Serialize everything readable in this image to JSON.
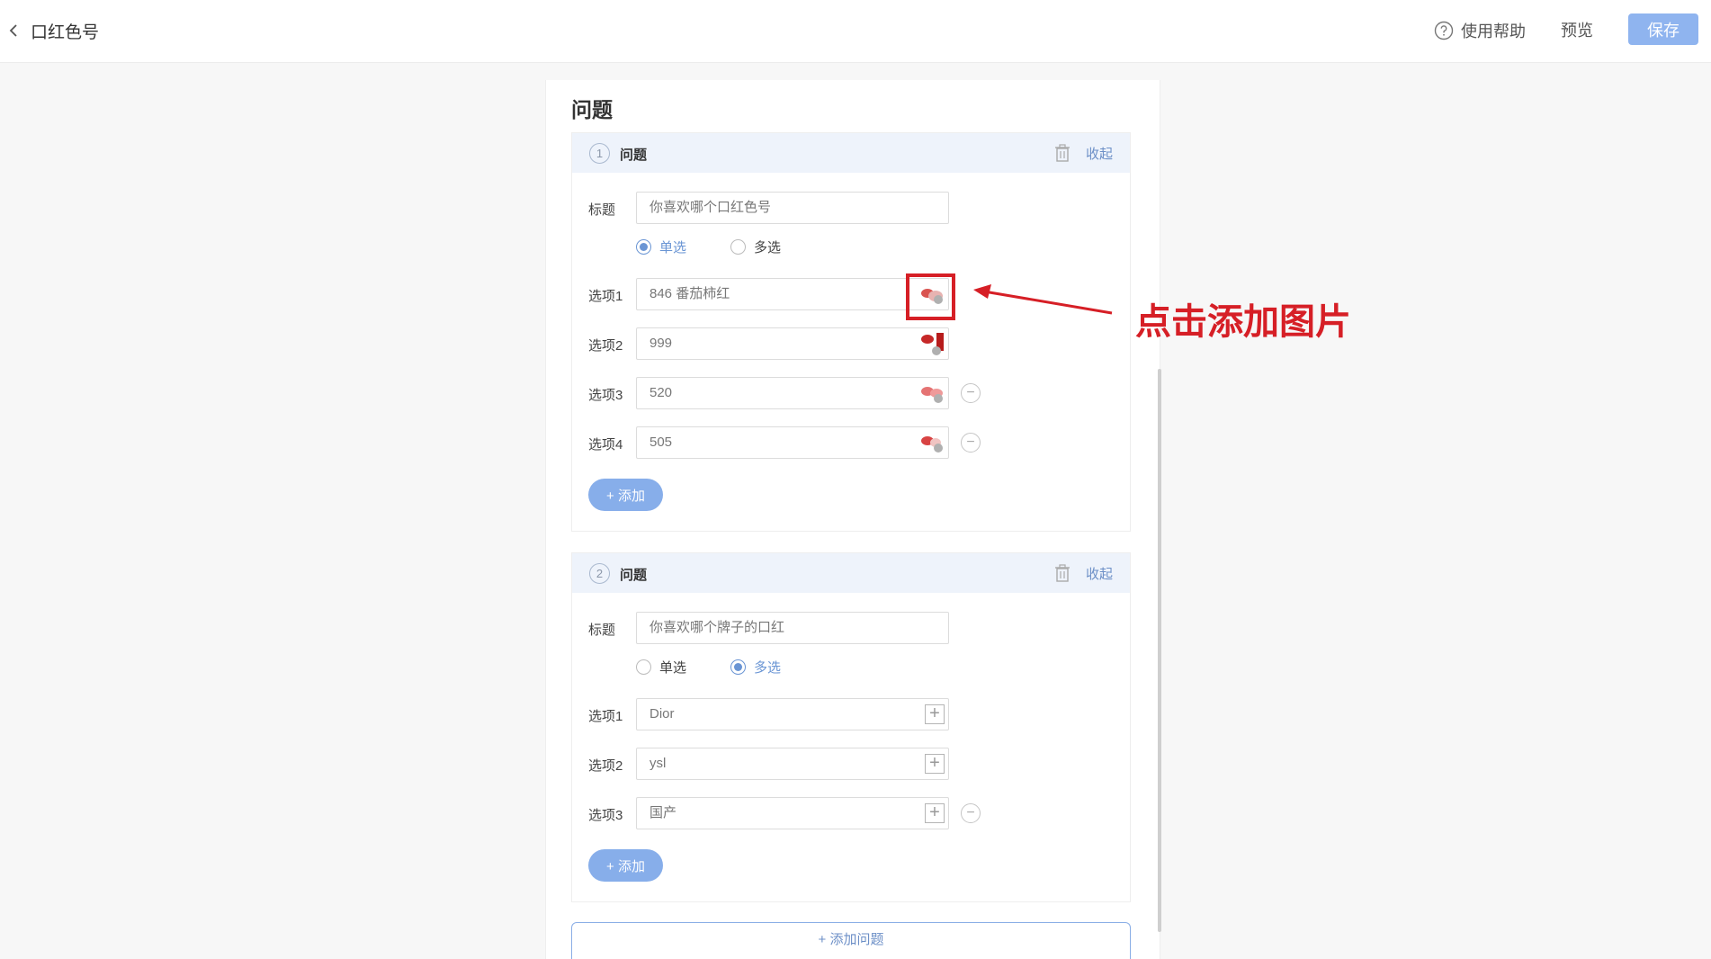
{
  "header": {
    "back_title": "口红色号",
    "help_label": "使用帮助",
    "preview_label": "预览",
    "save_label": "保存"
  },
  "panel": {
    "title": "问题"
  },
  "questions": [
    {
      "number": "1",
      "label": "问题",
      "collapse_label": "收起",
      "title_label": "标题",
      "title_value": "你喜欢哪个口红色号",
      "radio_single": "单选",
      "radio_multi": "多选",
      "selected": "single",
      "options": [
        {
          "label": "选项1",
          "value": "846 番茄柿红"
        },
        {
          "label": "选项2",
          "value": "999"
        },
        {
          "label": "选项3",
          "value": "520"
        },
        {
          "label": "选项4",
          "value": "505"
        }
      ],
      "add_label": "+ 添加"
    },
    {
      "number": "2",
      "label": "问题",
      "collapse_label": "收起",
      "title_label": "标题",
      "title_value": "你喜欢哪个牌子的口红",
      "radio_single": "单选",
      "radio_multi": "多选",
      "selected": "multi",
      "options": [
        {
          "label": "选项1",
          "value": "Dior"
        },
        {
          "label": "选项2",
          "value": "ysl"
        },
        {
          "label": "选项3",
          "value": "国产"
        }
      ],
      "add_label": "+ 添加"
    }
  ],
  "add_question_label": "+ 添加问题",
  "annotation": {
    "callout": "点击添加图片",
    "color": "#d61f26"
  },
  "colors": {
    "accent": "#6a95d4",
    "save_button": "#8fb4ef",
    "add_button": "#87aeea"
  }
}
